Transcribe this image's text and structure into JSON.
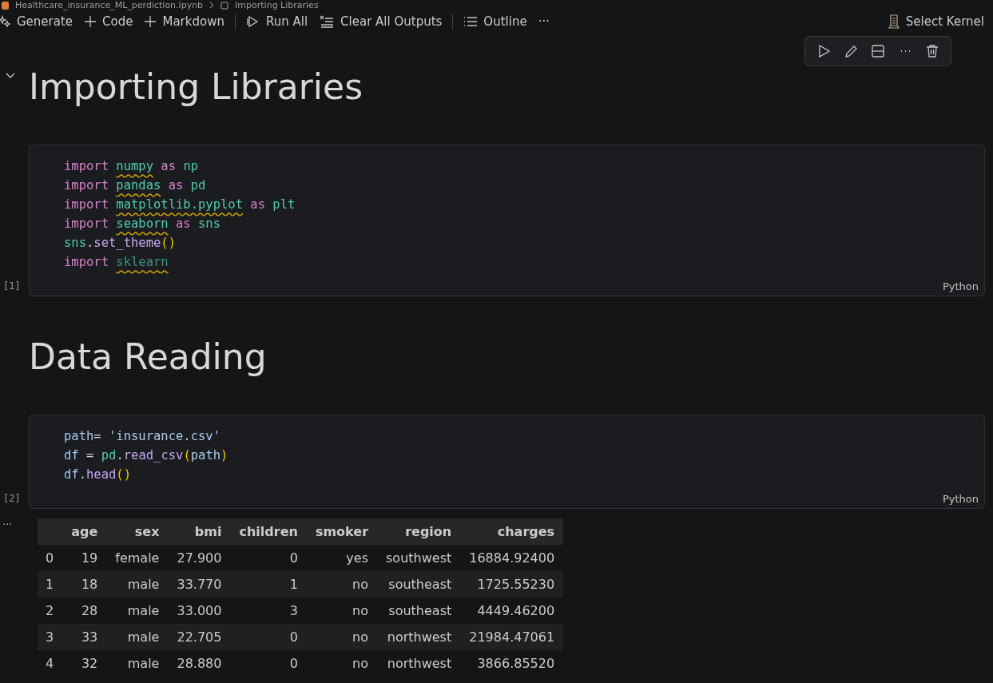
{
  "breadcrumb": [
    "Healthcare_insurance_ML_perdiction.ipynb",
    "Importing Libraries"
  ],
  "toolbar": {
    "groups": [
      [
        "Generate",
        "Code",
        "Markdown"
      ],
      [
        "Run All",
        "Clear All Outputs"
      ],
      [
        "Outline",
        "···"
      ]
    ],
    "kernel": "Select Kernel"
  },
  "cells": [
    {
      "kind": "markdown",
      "text": "Importing Libraries",
      "hovered": true
    },
    {
      "kind": "code",
      "execution_count": "[1]",
      "language": "Python",
      "lines": [
        [
          {
            "t": "import",
            "kind": "keyword",
            "space_after": true
          },
          {
            "t": "numpy",
            "kind": "module",
            "warning": true,
            "space_after": true
          },
          {
            "t": "as",
            "kind": "keyword",
            "space_after": true
          },
          {
            "t": "np",
            "kind": "module"
          }
        ],
        [
          {
            "t": "import",
            "kind": "keyword",
            "space_after": true
          },
          {
            "t": "pandas",
            "kind": "module",
            "warning": true,
            "space_after": true
          },
          {
            "t": "as",
            "kind": "keyword",
            "space_after": true
          },
          {
            "t": "pd",
            "kind": "module"
          }
        ],
        [
          {
            "t": "import",
            "kind": "keyword",
            "space_after": true
          },
          {
            "t": "matplotlib.pyplot",
            "kind": "module",
            "warning": true,
            "space_after": true
          },
          {
            "t": "as",
            "kind": "keyword",
            "space_after": true
          },
          {
            "t": "plt",
            "kind": "module"
          }
        ],
        [
          {
            "t": "import",
            "kind": "keyword",
            "space_after": true
          },
          {
            "t": "seaborn",
            "kind": "module",
            "warning": true,
            "space_after": true
          },
          {
            "t": "as",
            "kind": "keyword",
            "space_after": true
          },
          {
            "t": "sns",
            "kind": "module"
          }
        ],
        [
          {
            "t": "sns",
            "kind": "module"
          },
          {
            "t": ".",
            "kind": "plain"
          },
          {
            "t": "set_theme",
            "kind": "function"
          },
          {
            "t": "()",
            "kind": "bracket"
          }
        ],
        [
          {
            "t": "import",
            "kind": "keyword",
            "space_after": true
          },
          {
            "t": "sklearn",
            "kind": "unresolved",
            "warning": true
          }
        ]
      ]
    },
    {
      "kind": "markdown",
      "text": "Data Reading",
      "hovered": false
    },
    {
      "kind": "code",
      "execution_count": "[2]",
      "language": "Python",
      "lines": [
        [
          {
            "t": "path",
            "kind": "variable"
          },
          {
            "t": "=",
            "kind": "plain",
            "space_after": true
          },
          {
            "t": "'insurance.csv'",
            "kind": "string"
          }
        ],
        [
          {
            "t": "df",
            "kind": "variable",
            "space_after": true
          },
          {
            "t": "=",
            "kind": "plain",
            "space_after": true
          },
          {
            "t": "pd",
            "kind": "module"
          },
          {
            "t": ".",
            "kind": "plain"
          },
          {
            "t": "read_csv",
            "kind": "function"
          },
          {
            "t": "(",
            "kind": "bracket"
          },
          {
            "t": "path",
            "kind": "variable"
          },
          {
            "t": ")",
            "kind": "bracket"
          }
        ],
        [
          {
            "t": "df",
            "kind": "variable"
          },
          {
            "t": ".",
            "kind": "plain"
          },
          {
            "t": "head",
            "kind": "function"
          },
          {
            "t": "()",
            "kind": "bracket"
          }
        ]
      ]
    },
    {
      "kind": "output",
      "more": "...",
      "table": {
        "columns": [
          "",
          "age",
          "sex",
          "bmi",
          "children",
          "smoker",
          "region",
          "charges"
        ],
        "rows": [
          [
            "0",
            "19",
            "female",
            "27.900",
            "0",
            "yes",
            "southwest",
            "16884.92400"
          ],
          [
            "1",
            "18",
            "male",
            "33.770",
            "1",
            "no",
            "southeast",
            "1725.55230"
          ],
          [
            "2",
            "28",
            "male",
            "33.000",
            "3",
            "no",
            "southeast",
            "4449.46200"
          ],
          [
            "3",
            "33",
            "male",
            "22.705",
            "0",
            "no",
            "northwest",
            "21984.47061"
          ],
          [
            "4",
            "32",
            "male",
            "28.880",
            "0",
            "no",
            "northwest",
            "3866.85520"
          ]
        ]
      }
    }
  ]
}
